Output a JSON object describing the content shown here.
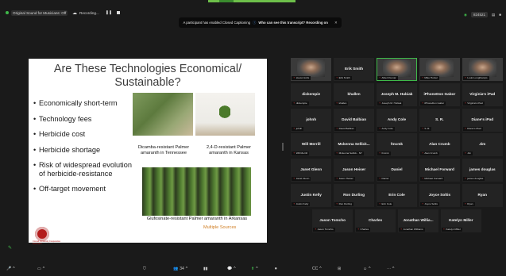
{
  "topbar": {
    "audio_label": "Original Sound for Musicians: Off",
    "recording_label": "Recording...",
    "banner_text": "A participant has enabled Closed Captioning",
    "banner_question": "Who can see this transcript? Recording on",
    "meeting_id": "824521"
  },
  "slide": {
    "title_line1": "Are These Technologies Economical/",
    "title_line2": "Sustainable?",
    "bullets": [
      "Economically short-term",
      "Technology fees",
      "Herbicide cost",
      "Herbicide shortage",
      "Risk of widespread evolution of herbicide-resistance",
      "Off-target movement"
    ],
    "caption1": "Dicamba-resistant Palmer amaranth in Tennessee",
    "caption2": "2,4-D-resistant Palmer amaranth in Kansas",
    "caption3": "Glufosinate-resistant Palmer amaranth in Arkansas",
    "sources": "Multiple Sources",
    "logo_text": "Cornell University Cooperative Extension"
  },
  "gallery": [
    {
      "name": "",
      "label": "steven kuhs",
      "video": true
    },
    {
      "name": "Erik Smith",
      "label": "Erik Smith",
      "video": false
    },
    {
      "name": "",
      "label": "Albert Kumar",
      "video": true,
      "active": true
    },
    {
      "name": "",
      "label": "Mike Hunter",
      "video": true
    },
    {
      "name": "",
      "label": "Louis Longthamps",
      "video": true
    },
    {
      "name": "dickempie",
      "label": "dickempie",
      "video": false
    },
    {
      "name": "khallen",
      "label": "khallen",
      "video": false
    },
    {
      "name": "Joseph M. Hubiak",
      "label": "Joseph M. Hubiak",
      "video": false
    },
    {
      "name": "iPhoneDon Gabor",
      "label": "iPhoneDon Gabor",
      "video": false
    },
    {
      "name": "Virginia's iPad",
      "label": "Virginia's iPad",
      "video": false
    },
    {
      "name": "johnh",
      "label": "johnh",
      "video": false
    },
    {
      "name": "David Balbian",
      "label": "David Balbian",
      "video": false
    },
    {
      "name": "Andy Cole",
      "label": "Andy Cole",
      "video": false
    },
    {
      "name": "S. R.",
      "label": "S. R.",
      "video": false
    },
    {
      "name": "Diane's iPad",
      "label": "Diane's iPad",
      "video": false
    },
    {
      "name": "Will Merrill",
      "label": "Will Merrill",
      "video": false
    },
    {
      "name": "Mckenna Sellick...",
      "label": "Mckenna Sellick - NY",
      "video": false
    },
    {
      "name": "fmcmk",
      "label": "fmcmk",
      "video": false
    },
    {
      "name": "Alan Crumb",
      "label": "Alan Crumb",
      "video": false
    },
    {
      "name": "Jim",
      "label": "Jim",
      "video": false
    },
    {
      "name": "Janet Glenn",
      "label": "Janet Glenn",
      "video": false
    },
    {
      "name": "Jason Heiser",
      "label": "Jason Heiser",
      "video": false
    },
    {
      "name": "Daniel",
      "label": "Daniel",
      "video": false
    },
    {
      "name": "Michael Forward",
      "label": "Michael Forward",
      "video": false
    },
    {
      "name": "james douglas",
      "label": "james douglas",
      "video": false
    },
    {
      "name": "Justin Kelly",
      "label": "Justin Kelly",
      "video": false
    },
    {
      "name": "Ron Durling",
      "label": "Ron Durling",
      "video": false
    },
    {
      "name": "Erin Cole",
      "label": "Erin Cole",
      "video": false
    },
    {
      "name": "Joyce Soltis",
      "label": "Joyce Soltis",
      "video": false
    },
    {
      "name": "Ryan",
      "label": "Ryan",
      "video": false
    },
    {
      "name": "Jason Tomcho",
      "label": "Jason Tomcho",
      "video": false
    },
    {
      "name": "Charles",
      "label": "Charles",
      "video": false
    },
    {
      "name": "Jonathan Willia...",
      "label": "Jonathan Williams",
      "video": false
    },
    {
      "name": "Katelyn Miller",
      "label": "Katelyn Miller",
      "video": false
    }
  ],
  "bottombar": {
    "participants_count": "34"
  }
}
